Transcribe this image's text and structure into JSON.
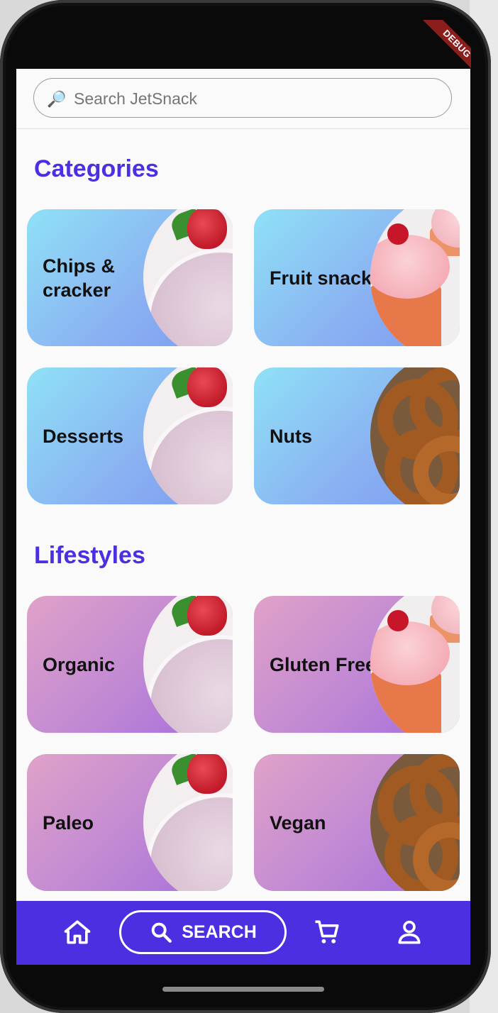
{
  "debug_banner": "DEBUG",
  "search": {
    "placeholder": "Search JetSnack"
  },
  "sections": [
    {
      "title": "Categories",
      "cards": [
        {
          "label": "Chips & cracker",
          "image": "yogurt-strawberry"
        },
        {
          "label": "Fruit snacks",
          "image": "cupcake"
        },
        {
          "label": "Desserts",
          "image": "yogurt-strawberry"
        },
        {
          "label": "Nuts",
          "image": "pretzel"
        }
      ]
    },
    {
      "title": "Lifestyles",
      "cards": [
        {
          "label": "Organic",
          "image": "yogurt-strawberry"
        },
        {
          "label": "Gluten Free",
          "image": "cupcake"
        },
        {
          "label": "Paleo",
          "image": "yogurt-strawberry"
        },
        {
          "label": "Vegan",
          "image": "pretzel"
        }
      ]
    }
  ],
  "bottom_nav": {
    "items": [
      {
        "icon": "home-icon"
      },
      {
        "label": "SEARCH",
        "icon": "search-icon",
        "selected": true
      },
      {
        "icon": "cart-icon"
      },
      {
        "icon": "profile-icon"
      }
    ]
  },
  "colors": {
    "accent": "#4b2fe0",
    "category_gradient": [
      "#8fe1f6",
      "#7c9bf0"
    ],
    "lifestyle_gradient": [
      "#e0a2c8",
      "#a46ddc"
    ]
  }
}
